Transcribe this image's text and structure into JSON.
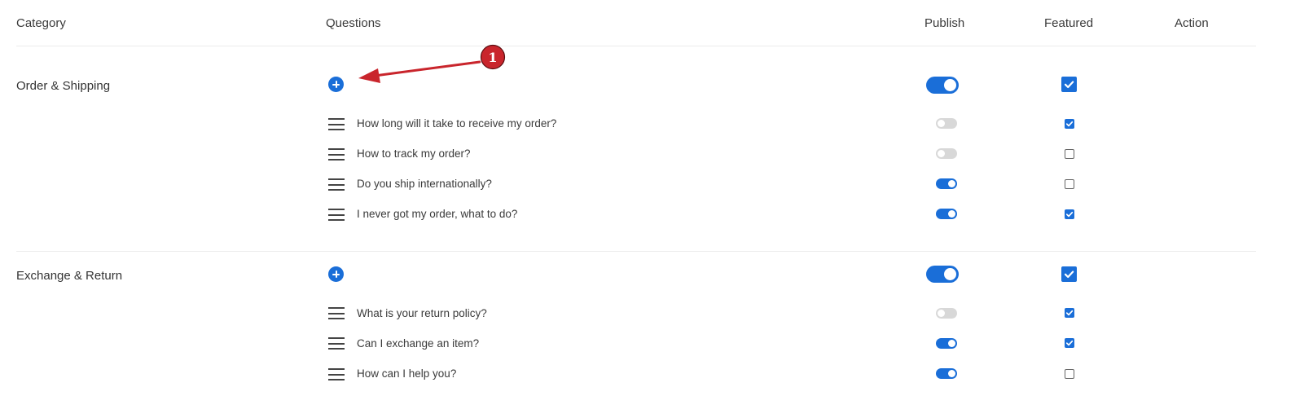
{
  "columns": {
    "category": "Category",
    "questions": "Questions",
    "publish": "Publish",
    "featured": "Featured",
    "action": "Action"
  },
  "categories": [
    {
      "name": "Order & Shipping",
      "publish": true,
      "featured": true,
      "questions": [
        {
          "text": "How long will it take to receive my order?",
          "publish": false,
          "featured": true
        },
        {
          "text": "How to track my order?",
          "publish": false,
          "featured": false
        },
        {
          "text": "Do you ship internationally?",
          "publish": true,
          "featured": false
        },
        {
          "text": "I never got my order, what to do?",
          "publish": true,
          "featured": true
        }
      ]
    },
    {
      "name": "Exchange & Return",
      "publish": true,
      "featured": true,
      "questions": [
        {
          "text": "What is your return policy?",
          "publish": false,
          "featured": true
        },
        {
          "text": "Can I exchange an item?",
          "publish": true,
          "featured": true
        },
        {
          "text": "How can I help you?",
          "publish": true,
          "featured": false
        }
      ]
    }
  ],
  "annotation": {
    "number": "1"
  },
  "colors": {
    "accent": "#1a6ed8",
    "toggle_off": "#d8d8d8",
    "annotation": "#c9252c"
  },
  "icons": {
    "add": "plus-circle-icon",
    "drag": "drag-handle-icon",
    "check": "checkmark-icon"
  }
}
